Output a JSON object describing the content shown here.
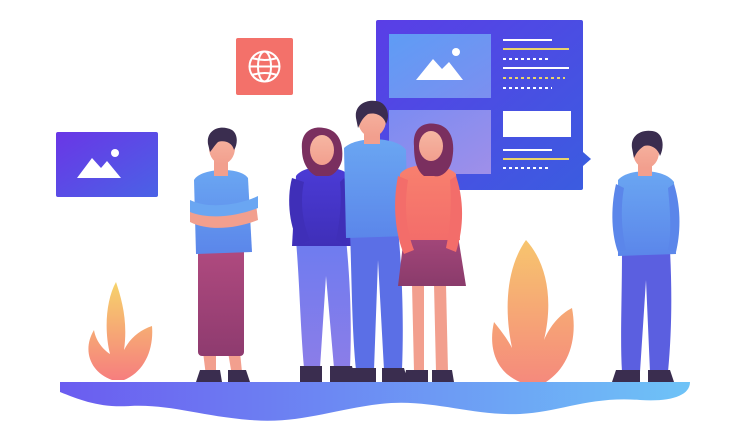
{
  "illustration": {
    "description_free": true,
    "icons": {
      "globe": "globe-icon",
      "image_left": "image-icon",
      "image_panel": "image-icon"
    },
    "colors": {
      "ground_start": "#6b5cf0",
      "ground_end": "#6ec3f7",
      "panel_start": "#5a3ee6",
      "panel_end": "#3b5ce0",
      "globe_tile": "#f3716a",
      "card_left_start": "#6a36e6",
      "card_left_end": "#4a62e6",
      "plant_top": "#f6d36b",
      "plant_bottom": "#f67e7e"
    }
  }
}
